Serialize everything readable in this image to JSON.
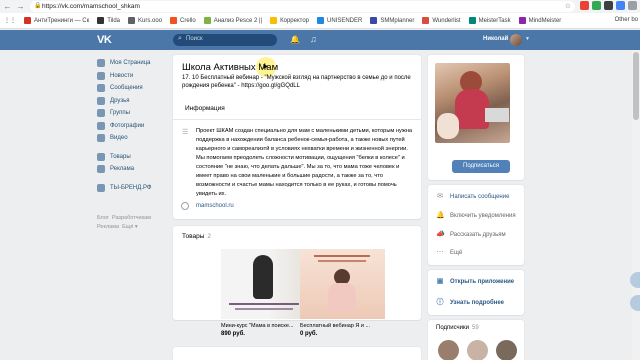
{
  "browser": {
    "url": "https://vk.com/mamschool_shkam",
    "bookmarks": [
      {
        "label": "АнтиТренинги — Ск",
        "color": "#d93025"
      },
      {
        "label": "Tilda",
        "color": "#333333"
      },
      {
        "label": "Kurs.ооо",
        "color": "#5f6368"
      },
      {
        "label": "Crello",
        "color": "#f4511e"
      },
      {
        "label": "Анализ Pesce 2 ||",
        "color": "#7cb342"
      },
      {
        "label": "Корректор",
        "color": "#fbbc04"
      },
      {
        "label": "UNISENDER",
        "color": "#1e88e5"
      },
      {
        "label": "SMMplanner",
        "color": "#3949ab"
      },
      {
        "label": "Wunderlist",
        "color": "#db4c3f"
      },
      {
        "label": "MeisterTask",
        "color": "#00897b"
      },
      {
        "label": "MindMeister",
        "color": "#8e24aa"
      }
    ],
    "other_bookmarks": "Other bo"
  },
  "header": {
    "logo": "VK",
    "search_placeholder": "Поиск",
    "user_name": "Николай"
  },
  "left_menu": {
    "items": [
      {
        "label": "Моя Страница",
        "icon": "home-icon"
      },
      {
        "label": "Новости",
        "icon": "news-icon"
      },
      {
        "label": "Сообщения",
        "icon": "messages-icon"
      },
      {
        "label": "Друзья",
        "icon": "friends-icon"
      },
      {
        "label": "Группы",
        "icon": "groups-icon"
      },
      {
        "label": "Фотографии",
        "icon": "photos-icon"
      },
      {
        "label": "Видео",
        "icon": "video-icon"
      }
    ],
    "items2": [
      {
        "label": "Товары",
        "icon": "goods-icon"
      },
      {
        "label": "Реклама",
        "icon": "ads-icon"
      }
    ],
    "items3": [
      {
        "label": "ТЫ-БРЕНД.РФ",
        "icon": "app-icon"
      }
    ],
    "footer": [
      "Блог",
      "Разработчикам",
      "Реклама",
      "Ещё"
    ]
  },
  "group": {
    "title": "Школа Активных Мам",
    "status": "17. 10 Бесплатный вебинар - \"Мужской взгляд на партнерство в семье до и после рождения ребенка\" - https://goo.gl/gGQdLL",
    "info_tab": "Информация",
    "description": "Проект ШКАМ создан специально для мам с маленькими детьми, которым нужна поддержка в нахождении баланса ребенок-семья-работа, а также новых путей карьерного и самореализтй в условиях нехватки времени и жизненной энергии. Мы помогаем преодолеть сложности мотивации, ощущения \"белки в колесе\" и состояние \"не знаю, что делать дальше\". Мы за то, что мама тоже человек и имеет право на свои маленькие и большие радости, а также за то, что возможности и счастье мамы находится только в ее руках, и готовы помочь увидеть их.",
    "site": "mamschool.ru"
  },
  "goods": {
    "title": "Товары",
    "count": "2",
    "items": [
      {
        "name": "Мини-курс \"Мама в поиске...",
        "price": "890 руб."
      },
      {
        "name": "Бесплатный вебинар Я и ...",
        "price": "0 руб."
      }
    ]
  },
  "right": {
    "subscribe": "Подписаться",
    "actions": [
      {
        "label": "Написать сообщение",
        "icon": "message-icon",
        "link": true
      },
      {
        "label": "Включить уведомления",
        "icon": "bell-icon",
        "link": false
      },
      {
        "label": "Рассказать друзьям",
        "icon": "megaphone-icon",
        "link": false
      },
      {
        "label": "Ещё",
        "icon": "more-icon",
        "link": false
      }
    ],
    "apps": [
      {
        "label": "Открыть приложение",
        "icon": "app-open-icon"
      },
      {
        "label": "Узнать подробнее",
        "icon": "info-icon"
      }
    ],
    "subscribers_title": "Подписчики",
    "subscribers_count": "59"
  }
}
